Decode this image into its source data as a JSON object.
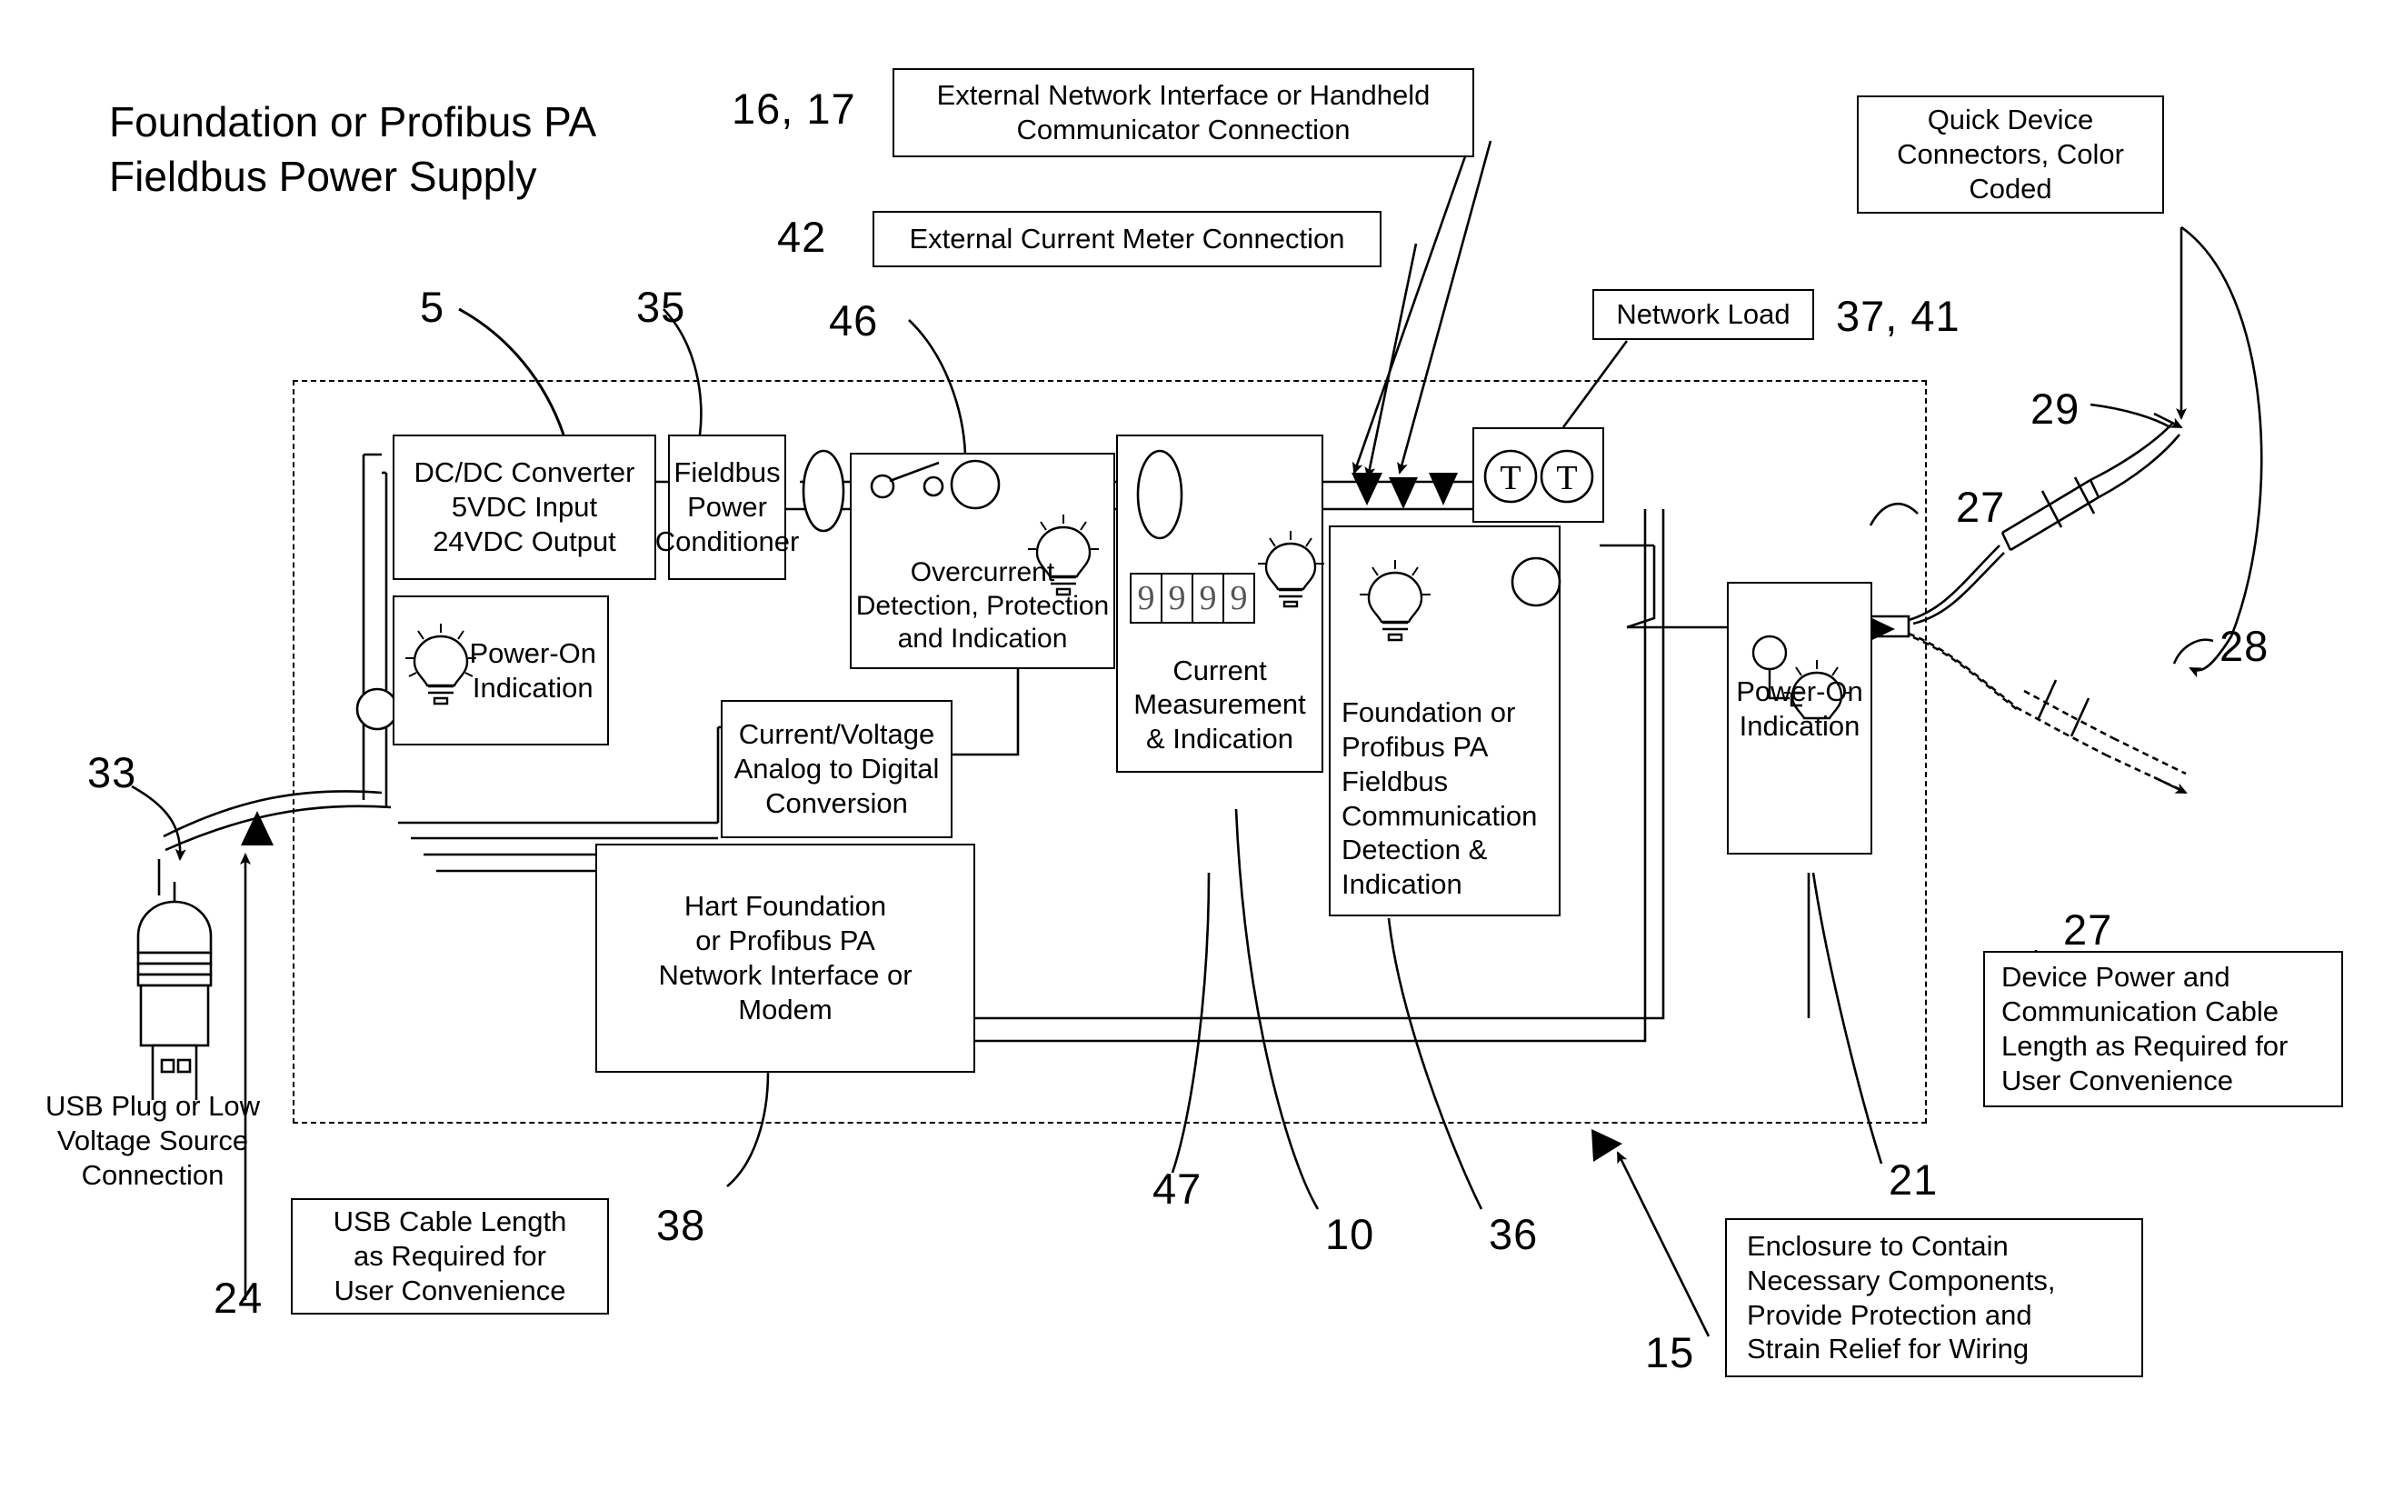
{
  "figure": {
    "title": "Foundation or Profibus PA\nFieldbus Power Supply",
    "domain_note": "patent block diagram"
  },
  "callout_boxes": {
    "external_network": "External Network Interface or Handheld\nCommunicator Connection",
    "external_current_meter": "External Current Meter Connection",
    "quick_device_connectors": "Quick Device\nConnectors, Color\nCoded",
    "network_load": "Network Load",
    "device_power_cable": "Device Power and\nCommunication Cable\nLength as Required for\nUser Convenience",
    "usb_cable_length": "USB Cable Length\nas Required for\nUser Convenience",
    "enclosure_note": "Enclosure to Contain\nNecessary Components,\nProvide Protection and\nStrain Relief for Wiring"
  },
  "blocks": {
    "dcdc": "DC/DC Converter\n5VDC Input\n24VDC Output",
    "fieldbus_conditioner": "Fieldbus\nPower\nConditioner",
    "power_on_left": "Power-On\nIndication",
    "overcurrent": "Overcurrent\nDetection, Protection\nand Indication",
    "current_measurement": "Current\nMeasurement\n& Indication",
    "fieldbus_comm": "Foundation or\nProfibus PA\nFieldbus\nCommunication\nDetection &\nIndication",
    "adc": "Current/Voltage\nAnalog to Digital\nConversion",
    "modem": "Hart Foundation\nor Profibus PA\nNetwork Interface or\nModem",
    "power_on_right": "Power-On\nIndication"
  },
  "labels": {
    "usb_plug": "USB Plug or Low\nVoltage Source\nConnection"
  },
  "meter_digits": [
    "9",
    "9",
    "9",
    "9"
  ],
  "terminals": [
    "T",
    "T"
  ],
  "reference_numbers": {
    "r16_17": "16, 17",
    "r42": "42",
    "r5": "5",
    "r35": "35",
    "r46": "46",
    "r37_41": "37, 41",
    "r29": "29",
    "r27_top": "27",
    "r28": "28",
    "r33": "33",
    "r24": "24",
    "r38": "38",
    "r47": "47",
    "r10": "10",
    "r36": "36",
    "r21": "21",
    "r15": "15",
    "r27_right": "27"
  },
  "colors": {
    "ink": "#000000",
    "paper": "#ffffff",
    "digit": "#555555"
  }
}
